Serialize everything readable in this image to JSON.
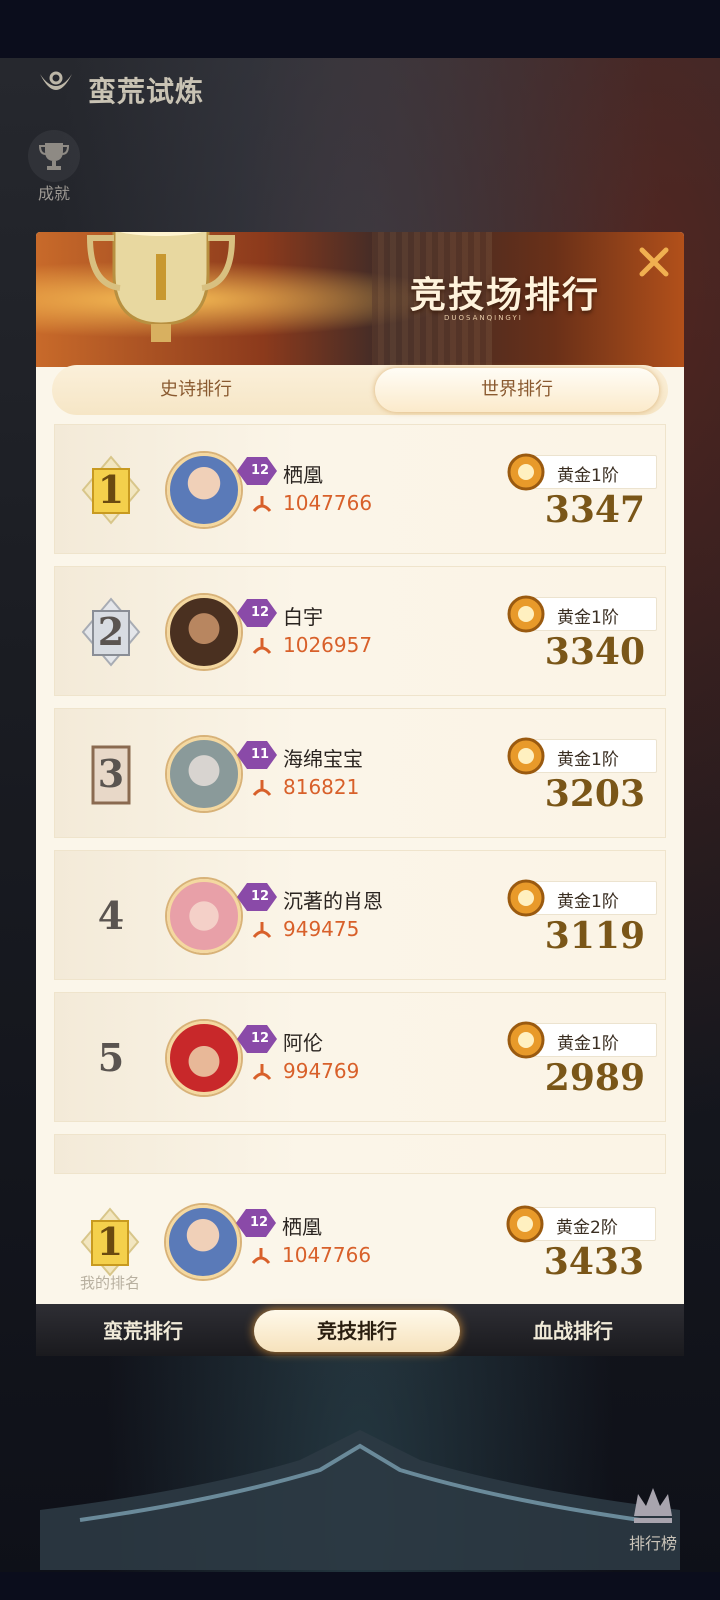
{
  "header": {
    "title": "蛮荒试炼",
    "achievement_label": "成就"
  },
  "dialog": {
    "title": "竞技场排行",
    "subtitle": "DUOSANQINGYI",
    "tabs": [
      {
        "label": "史诗排行",
        "active": false
      },
      {
        "label": "世界排行",
        "active": true
      }
    ]
  },
  "rankings": [
    {
      "rank": "1",
      "level": "12",
      "name": "栖凰",
      "power": "1047766",
      "tier": "黄金1阶",
      "score": "3347"
    },
    {
      "rank": "2",
      "level": "12",
      "name": "白宇",
      "power": "1026957",
      "tier": "黄金1阶",
      "score": "3340"
    },
    {
      "rank": "3",
      "level": "11",
      "name": "海绵宝宝",
      "power": "816821",
      "tier": "黄金1阶",
      "score": "3203"
    },
    {
      "rank": "4",
      "level": "12",
      "name": "沉著的肖恩",
      "power": "949475",
      "tier": "黄金1阶",
      "score": "3119"
    },
    {
      "rank": "5",
      "level": "12",
      "name": "阿伦",
      "power": "994769",
      "tier": "黄金1阶",
      "score": "2989"
    }
  ],
  "my_rank": {
    "label": "我的排名",
    "rank": "1",
    "level": "12",
    "name": "栖凰",
    "power": "1047766",
    "tier": "黄金2阶",
    "score": "3433"
  },
  "bottom_tabs": [
    {
      "label": "蛮荒排行",
      "active": false
    },
    {
      "label": "竞技排行",
      "active": true
    },
    {
      "label": "血战排行",
      "active": false
    }
  ],
  "leaderboard_button": {
    "label": "排行榜"
  },
  "colors": {
    "accent_gold": "#7a5618",
    "power_red": "#d8602a",
    "panel_bg": "#fbf6ea"
  }
}
